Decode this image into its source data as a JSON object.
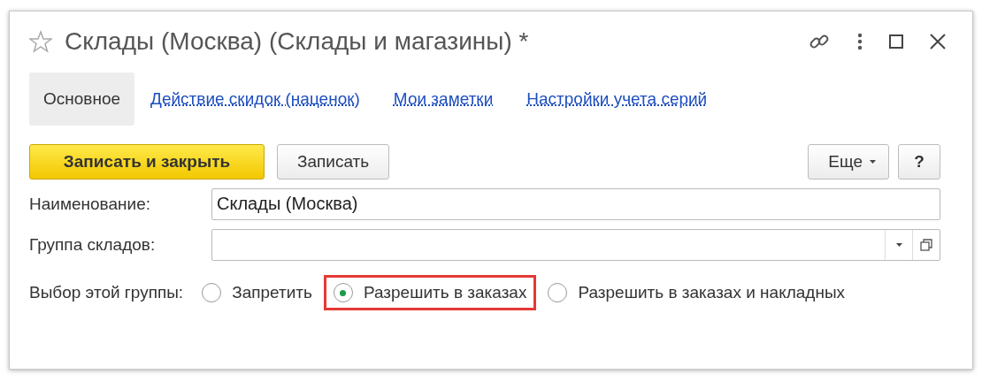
{
  "window": {
    "title": "Склады (Москва) (Склады и магазины) *",
    "favorite": false
  },
  "tabs": [
    {
      "label": "Основное",
      "selected": true
    },
    {
      "label": "Действие скидок (наценок)",
      "selected": false
    },
    {
      "label": "Мои заметки",
      "selected": false
    },
    {
      "label": "Настройки учета серий",
      "selected": false
    }
  ],
  "toolbar": {
    "primary_button": "Записать и закрыть",
    "save_button": "Записать",
    "more_button": "Еще",
    "help_button": "?"
  },
  "fields": [
    {
      "kind": "text",
      "label": "Наименование:",
      "value": "Склады (Москва)"
    },
    {
      "kind": "select",
      "label": "Группа складов:"
    }
  ],
  "group_choice": {
    "label": "Выбор этой группы:",
    "options": [
      {
        "label": "Запретить",
        "selected": false,
        "highlighted": false
      },
      {
        "label": "Разрешить в заказах",
        "selected": true,
        "highlighted": true
      },
      {
        "label": "Разрешить в заказах и накладных",
        "selected": false,
        "highlighted": false
      }
    ]
  }
}
